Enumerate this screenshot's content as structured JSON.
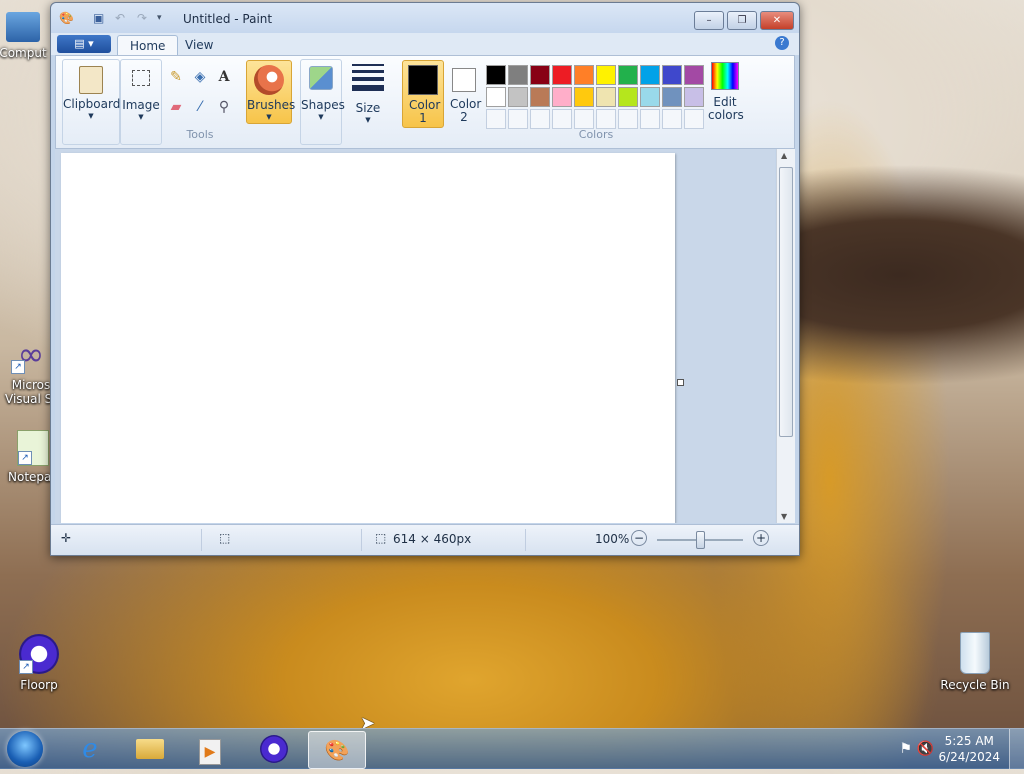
{
  "desktop": {
    "icons": [
      {
        "label": "Comput"
      },
      {
        "label": "Micros Visual St"
      },
      {
        "label": "Notepac"
      },
      {
        "label": "Floorp"
      },
      {
        "label": "Recycle Bin"
      }
    ]
  },
  "window": {
    "title": "Untitled - Paint",
    "controls": {
      "minimize": "–",
      "maximize": "❐",
      "close": "✕"
    }
  },
  "ribbon": {
    "tabs": [
      {
        "label": "Home"
      },
      {
        "label": "View"
      }
    ],
    "groups": {
      "clipboard": "Clipboard",
      "image": "Image",
      "tools": "Tools",
      "brushes": "Brushes",
      "shapes": "Shapes",
      "size": "Size",
      "color1": "Color 1",
      "color2": "Color 2",
      "colors": "Colors",
      "edit_colors": "Edit colors"
    },
    "palette_row1": [
      "#000000",
      "#7f7f7f",
      "#880015",
      "#ed1c24",
      "#ff7f27",
      "#fff200",
      "#22b14c",
      "#00a2e8",
      "#3f48cc",
      "#a349a4"
    ],
    "palette_row2": [
      "#ffffff",
      "#c3c3c3",
      "#b97a57",
      "#ffaec9",
      "#ffc90e",
      "#efe4b0",
      "#b5e61d",
      "#99d9ea",
      "#7092be",
      "#c8bfe7"
    ],
    "color1_value": "#000000",
    "color2_value": "#ffffff"
  },
  "status": {
    "dimensions": "614 × 460px",
    "zoom": "100%"
  },
  "taskbar": {
    "time": "5:25 AM",
    "date": "6/24/2024"
  }
}
